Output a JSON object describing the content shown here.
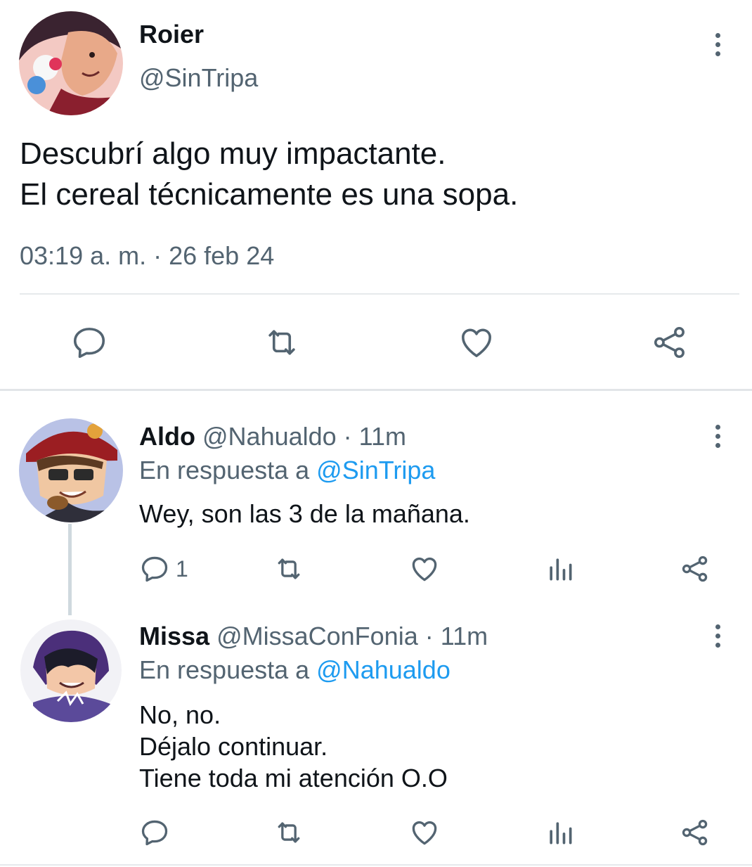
{
  "main_tweet": {
    "author_name": "Roier",
    "author_handle": "@SinTripa",
    "text_line1": "Descubrí algo muy impactante.",
    "text_line2": "El cereal técnicamente es una sopa.",
    "timestamp": "03:19 a. m. · 26 feb 24"
  },
  "replies": [
    {
      "author_name": "Aldo",
      "author_handle": "@Nahualdo",
      "time": " · 11m",
      "reply_prefix": "En respuesta a ",
      "reply_to": "@SinTripa",
      "text": "Wey, son las 3 de la mañana.",
      "reply_count": "1"
    },
    {
      "author_name": "Missa",
      "author_handle": "@MissaConFonia",
      "time": " · 11m",
      "reply_prefix": "En respuesta a ",
      "reply_to": "@Nahualdo",
      "text_line1": "No, no.",
      "text_line2": "Déjalo continuar.",
      "text_line3": "Tiene toda mi atención O.O"
    }
  ],
  "icons": {
    "reply": "speech-bubble-icon",
    "retweet": "retweet-arrows-icon",
    "like": "heart-icon",
    "views": "bar-chart-icon",
    "share": "share-nodes-icon",
    "more": "vertical-ellipsis-icon"
  },
  "colors": {
    "text": "#0f1419",
    "muted": "#536471",
    "link": "#1d9bf0",
    "divider": "#e6e9ec"
  }
}
